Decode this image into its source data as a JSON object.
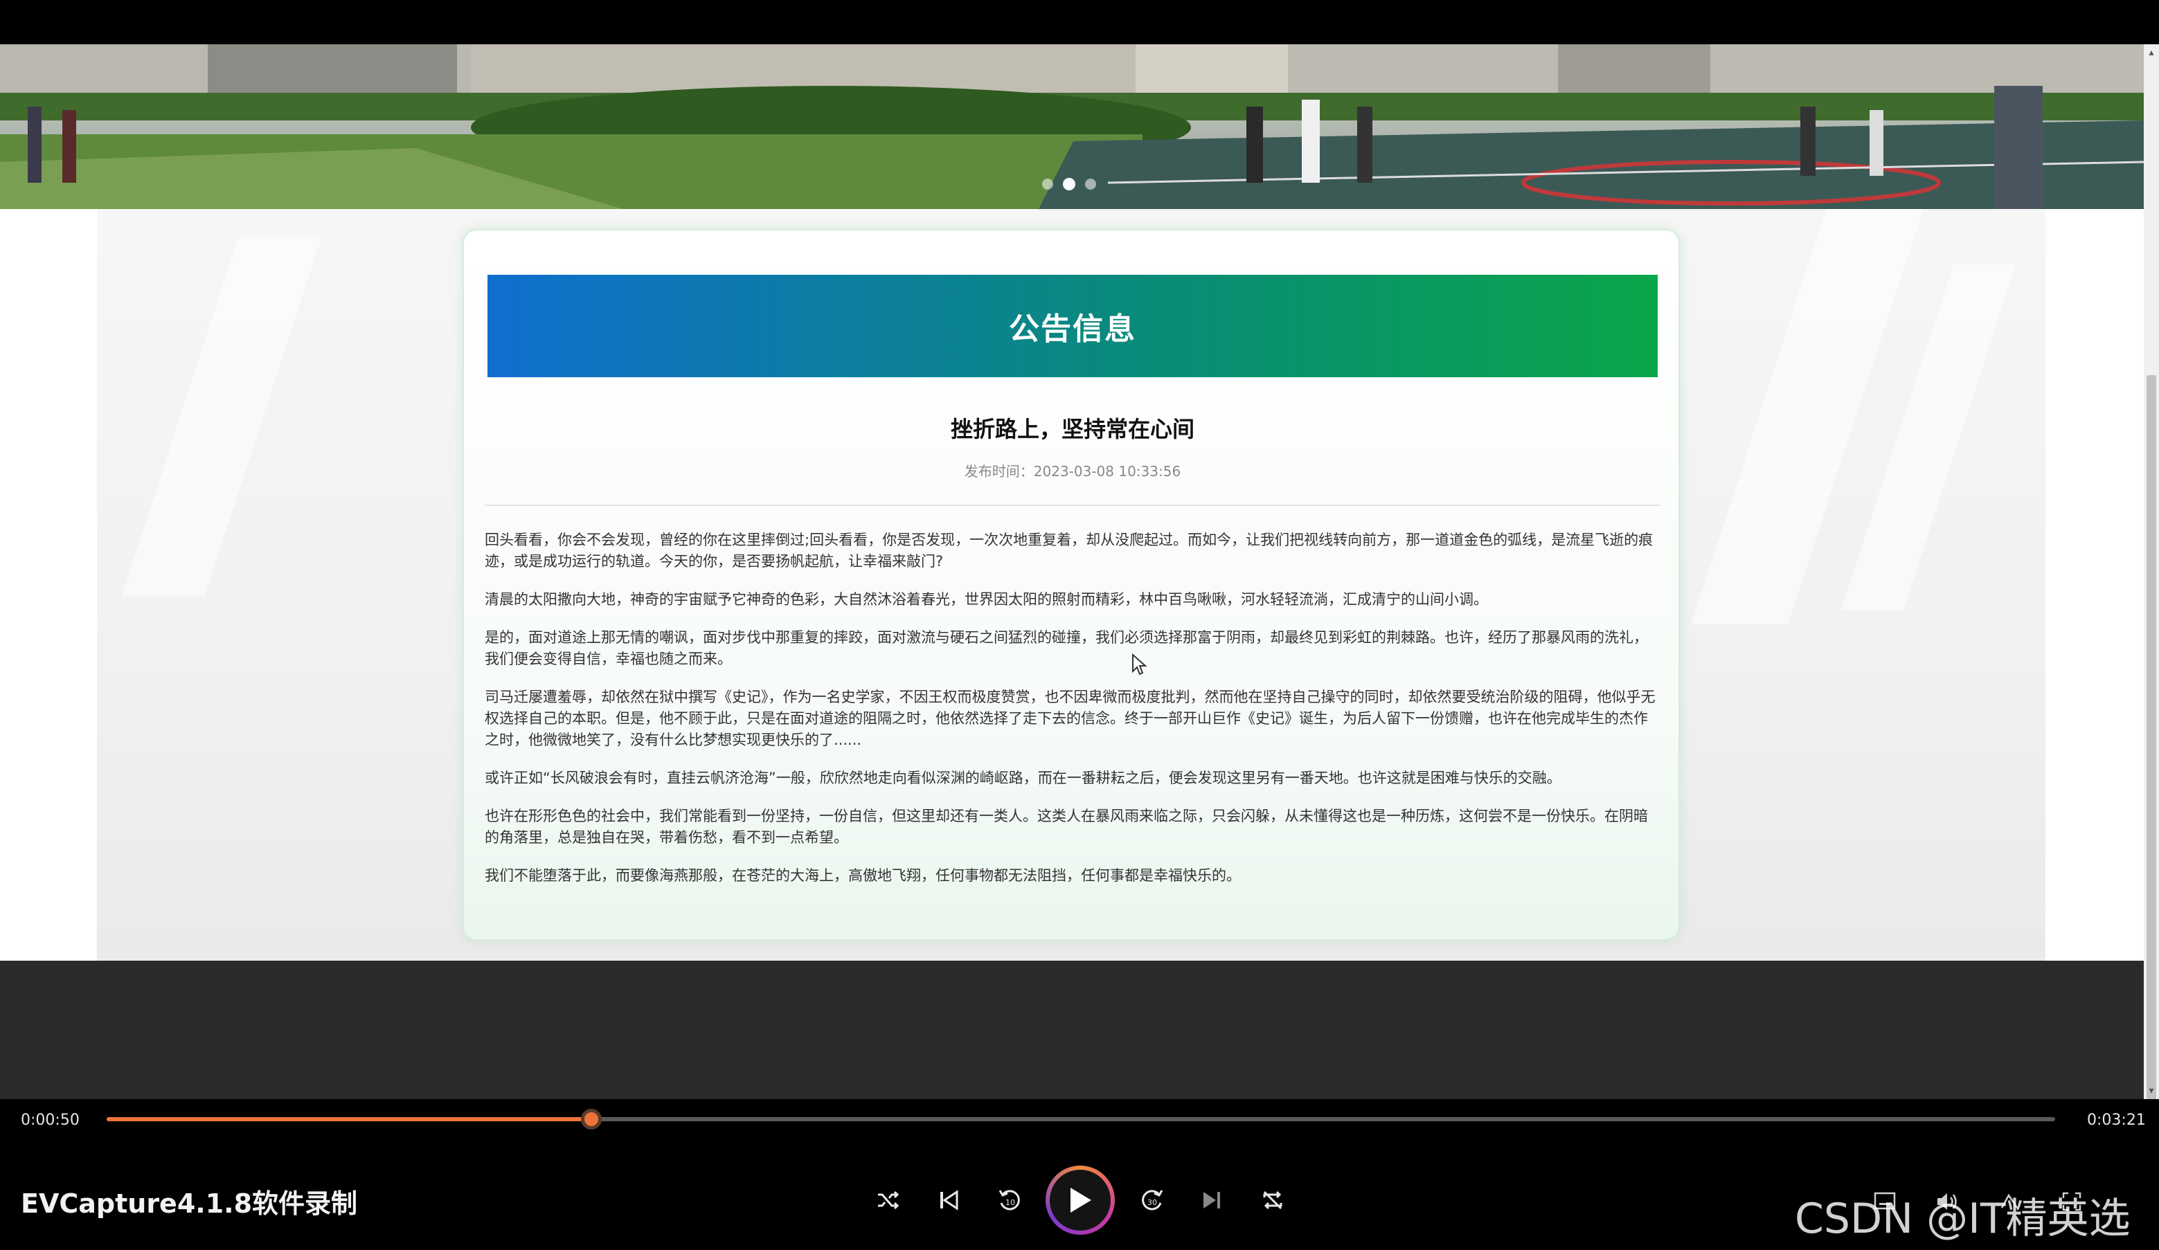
{
  "banner": {
    "carousel": {
      "count": 3,
      "active_index": 1
    }
  },
  "card": {
    "header": "公告信息",
    "article": {
      "title": "挫折路上，坚持常在心间",
      "meta": "发布时间：2023-03-08 10:33:56",
      "paragraphs": [
        "回头看看，你会不会发现，曾经的你在这里摔倒过;回头看看，你是否发现，一次次地重复着，却从没爬起过。而如今，让我们把视线转向前方，那一道道金色的弧线，是流星飞逝的痕迹，或是成功运行的轨道。今天的你，是否要扬帆起航，让幸福来敲门?",
        "清晨的太阳撒向大地，神奇的宇宙赋予它神奇的色彩，大自然沐浴着春光，世界因太阳的照射而精彩，林中百鸟啾啾，河水轻轻流淌，汇成清宁的山间小调。",
        "是的，面对道途上那无情的嘲讽，面对步伐中那重复的摔跤，面对激流与硬石之间猛烈的碰撞，我们必须选择那富于阴雨，却最终见到彩虹的荆棘路。也许，经历了那暴风雨的洗礼，我们便会变得自信，幸福也随之而来。",
        "司马迁屡遭羞辱，却依然在狱中撰写《史记》，作为一名史学家，不因王权而极度赞赏，也不因卑微而极度批判，然而他在坚持自己操守的同时，却依然要受统治阶级的阻碍，他似乎无权选择自己的本职。但是，他不顾于此，只是在面对道途的阻隔之时，他依然选择了走下去的信念。终于一部开山巨作《史记》诞生，为后人留下一份馈赠，也许在他完成毕生的杰作之时，他微微地笑了，没有什么比梦想实现更快乐的了......",
        "或许正如“长风破浪会有时，直挂云帆济沧海”一般，欣欣然地走向看似深渊的崎岖路，而在一番耕耘之后，便会发现这里另有一番天地。也许这就是困难与快乐的交融。",
        "也许在形形色色的社会中，我们常能看到一份坚持，一份自信，但这里却还有一类人。这类人在暴风雨来临之际，只会闪躲，从未懂得这也是一种历炼，这何尝不是一份快乐。在阴暗的角落里，总是独自在哭，带着伤愁，看不到一点希望。",
        "我们不能堕落于此，而要像海燕那般，在苍茫的大海上，高傲地飞翔，任何事物都无法阻挡，任何事都是幸福快乐的。"
      ]
    }
  },
  "player": {
    "current_time": "0:00:50",
    "total_time": "0:03:21",
    "progress": 0.2488,
    "title": "EVCapture4.1.8软件录制",
    "controls": [
      "shuffle-icon",
      "previous-icon",
      "rewind-10-icon",
      "play-icon",
      "forward-30-icon",
      "next-icon",
      "repeat-icon"
    ],
    "accent": "#f0743a"
  },
  "watermark": "CSDN @IT精英选手"
}
